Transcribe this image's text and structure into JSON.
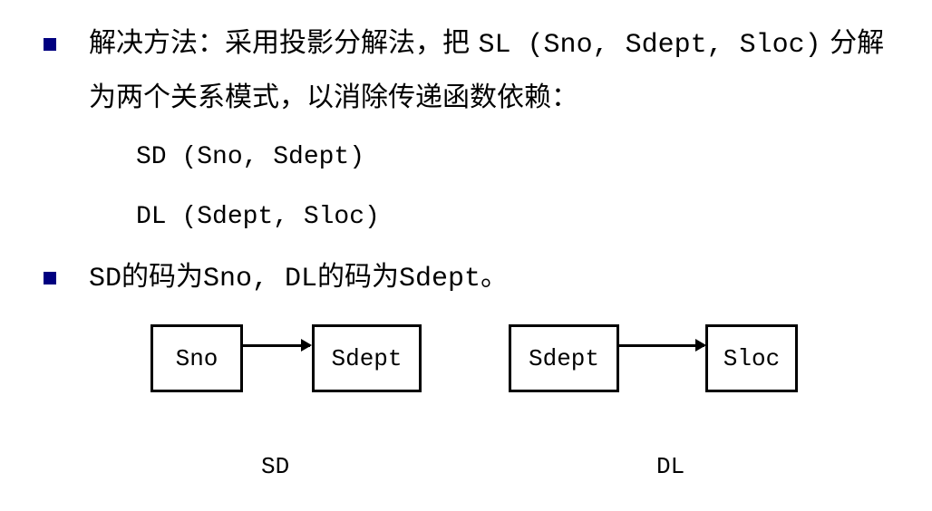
{
  "bullet1": {
    "line1_cn": "解决方法：采用投影分解法，把 ",
    "line1_code": "SL (Sno, Sdept, Sloc)",
    "line1_tail": " 分解",
    "line2": "为两个关系模式，以消除传递函数依赖："
  },
  "schemas": [
    "SD (Sno,  Sdept)",
    "DL (Sdept,  Sloc)"
  ],
  "bullet2": {
    "p1": "SD",
    "p2": "的码为",
    "p3": "Sno,  DL",
    "p4": "的码为",
    "p5": "Sdept",
    "p6": "。"
  },
  "diagrams": {
    "sd": {
      "from": "Sno",
      "to": "Sdept",
      "caption": "SD"
    },
    "dl": {
      "from": "Sdept",
      "to": "Sloc",
      "caption": "DL"
    }
  },
  "colors": {
    "bullet": "#000080",
    "text": "#000000"
  }
}
